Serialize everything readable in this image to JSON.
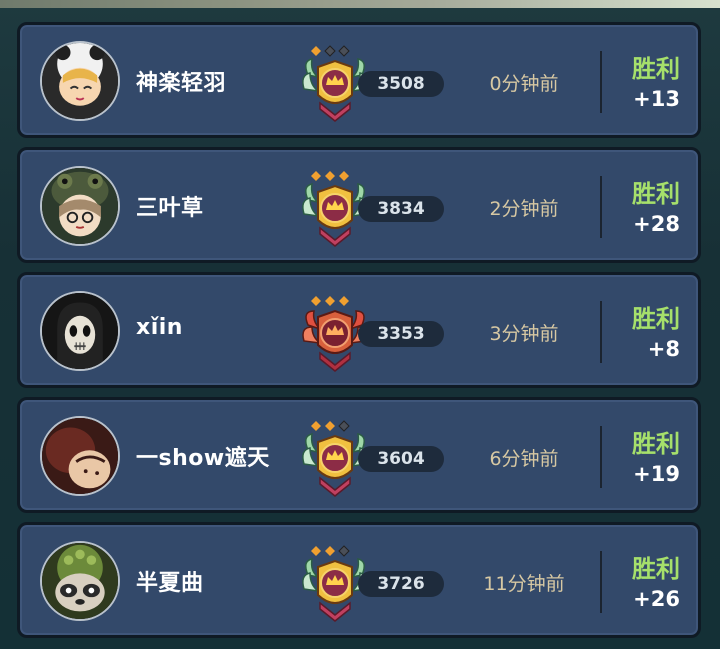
{
  "matches": [
    {
      "player": "神楽轻羽",
      "avatar": "panda-hood-avatar",
      "rank_tier": "gold-wreath",
      "stars_filled": 1,
      "stars_total": 3,
      "score": "3508",
      "time_ago": "0分钟前",
      "result": "胜利",
      "delta": "+13"
    },
    {
      "player": "三叶草",
      "avatar": "frog-hood-avatar",
      "rank_tier": "gold-wreath",
      "stars_filled": 3,
      "stars_total": 3,
      "score": "3834",
      "time_ago": "2分钟前",
      "result": "胜利",
      "delta": "+28"
    },
    {
      "player": "xǐin",
      "avatar": "skull-mask-avatar",
      "rank_tier": "red-wings",
      "stars_filled": 3,
      "stars_total": 3,
      "score": "3353",
      "time_ago": "3分钟前",
      "result": "胜利",
      "delta": "+8"
    },
    {
      "player": "一show遮天",
      "avatar": "dark-character-avatar",
      "rank_tier": "gold-wreath",
      "stars_filled": 2,
      "stars_total": 3,
      "score": "3604",
      "time_ago": "6分钟前",
      "result": "胜利",
      "delta": "+19"
    },
    {
      "player": "半夏曲",
      "avatar": "raccoon-avatar",
      "rank_tier": "gold-wreath",
      "stars_filled": 2,
      "stars_total": 3,
      "score": "3726",
      "time_ago": "11分钟前",
      "result": "胜利",
      "delta": "+26"
    }
  ],
  "colors": {
    "win": "#a6e06b",
    "time": "#d7c8a3",
    "row_bg": "#33496a",
    "star_on": "#f0a030",
    "star_off": "#4a4f58"
  }
}
